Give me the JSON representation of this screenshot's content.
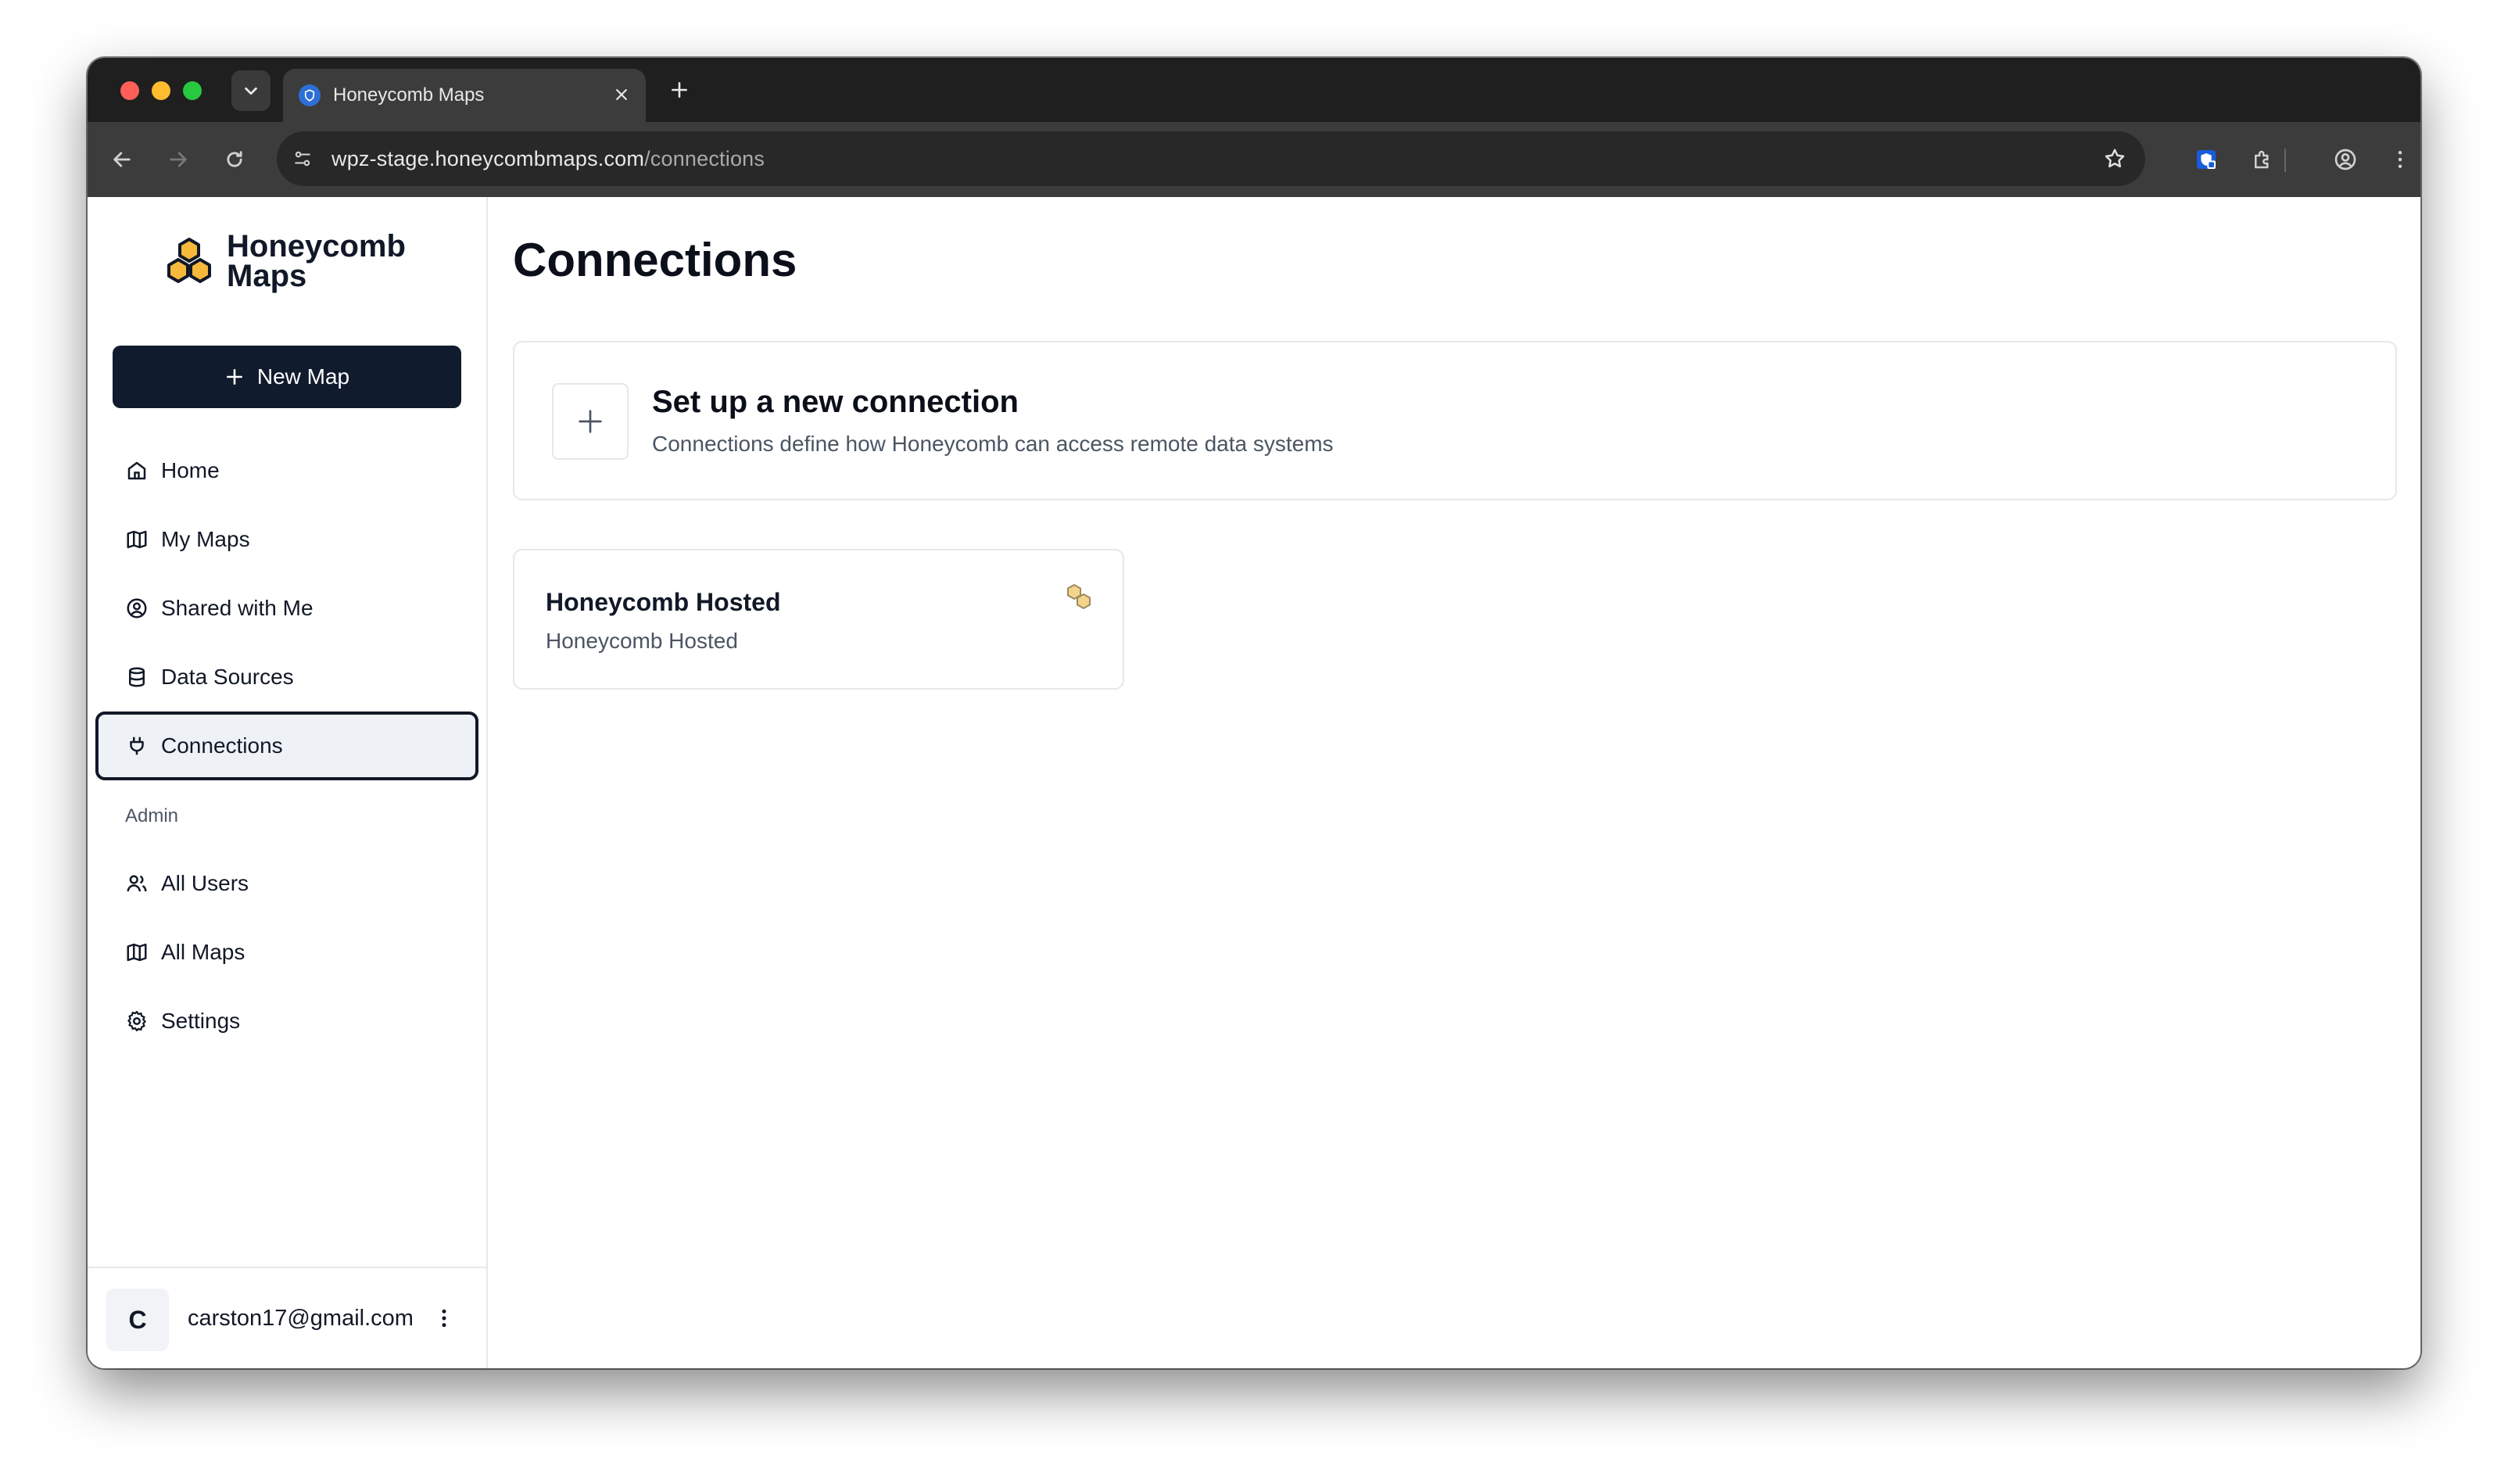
{
  "browser": {
    "tab_title": "Honeycomb Maps",
    "url_host": "wpz-stage.honeycombmaps.com",
    "url_path": "/connections"
  },
  "sidebar": {
    "brand_line1": "Honeycomb",
    "brand_line2": "Maps",
    "new_map_label": "New Map",
    "items": [
      {
        "label": "Home",
        "icon": "home-icon"
      },
      {
        "label": "My Maps",
        "icon": "map-icon"
      },
      {
        "label": "Shared with Me",
        "icon": "user-circle-icon"
      },
      {
        "label": "Data Sources",
        "icon": "database-icon"
      },
      {
        "label": "Connections",
        "icon": "plug-icon",
        "active": true
      }
    ],
    "admin_label": "Admin",
    "admin_items": [
      {
        "label": "All Users",
        "icon": "users-icon"
      },
      {
        "label": "All Maps",
        "icon": "map-icon"
      },
      {
        "label": "Settings",
        "icon": "gear-icon"
      }
    ],
    "user": {
      "avatar_initial": "C",
      "email": "carston17@gmail.com"
    }
  },
  "main": {
    "title": "Connections",
    "setup_card": {
      "title": "Set up a new connection",
      "description": "Connections define how Honeycomb can access remote data systems"
    },
    "connections": [
      {
        "title": "Honeycomb Hosted",
        "subtitle": "Honeycomb Hosted"
      }
    ]
  },
  "colors": {
    "primary_button": "#111b2e",
    "brand_yellow": "#f6b93b",
    "active_nav_bg": "#eef2f7"
  }
}
